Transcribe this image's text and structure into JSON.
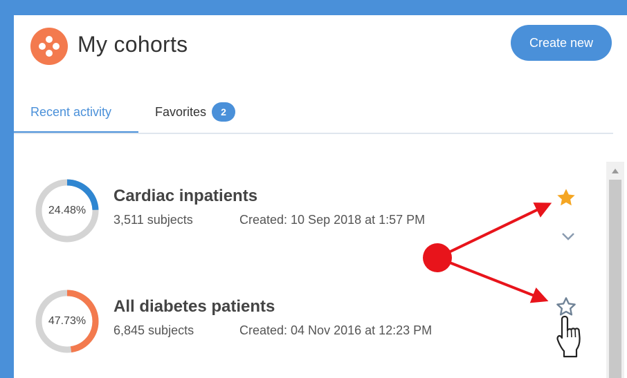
{
  "header": {
    "title": "My cohorts",
    "create_button_label": "Create new"
  },
  "tabs": [
    {
      "label": "Recent activity",
      "active": true
    },
    {
      "label": "Favorites",
      "badge": "2",
      "active": false
    }
  ],
  "cohorts": [
    {
      "name": "Cardiac inpatients",
      "percent_label": "24.48%",
      "percent": 24.48,
      "ring_color": "#2f86d1",
      "subjects": "3,511 subjects",
      "created": "Created: 10 Sep 2018 at 1:57 PM",
      "favorite": true
    },
    {
      "name": "All diabetes patients",
      "percent_label": "47.73%",
      "percent": 47.73,
      "ring_color": "#f37a4e",
      "subjects": "6,845 subjects",
      "created": "Created: 04 Nov 2016 at 12:23 PM",
      "favorite": false
    }
  ],
  "colors": {
    "accent": "#4a90d9",
    "logo": "#f37a4e",
    "star_filled": "#f5a623",
    "arrow": "#e8141b"
  },
  "icons": [
    "cohorts-logo-icon",
    "star-filled-icon",
    "star-outline-icon",
    "chevron-down-icon",
    "hand-pointer-icon"
  ]
}
